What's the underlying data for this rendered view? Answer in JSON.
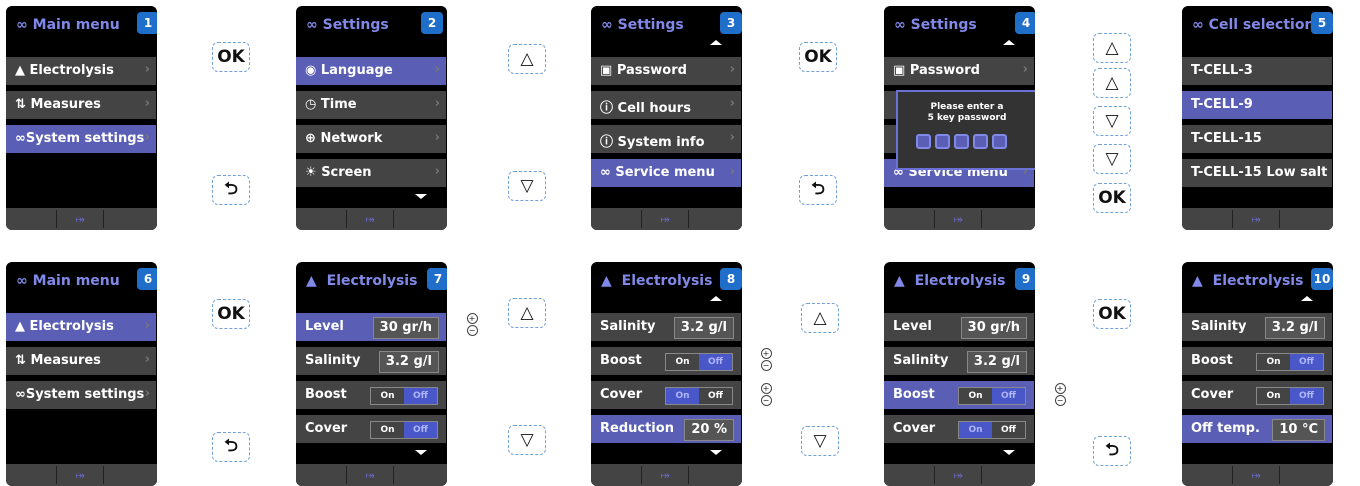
{
  "colors": {
    "accent": "#5a5fb5",
    "title": "#8089e8",
    "badge": "#1f6ec9",
    "row": "#444444"
  },
  "keys": {
    "ok": "OK",
    "up": "△",
    "down": "▽",
    "back": "⮌"
  },
  "screens": [
    {
      "badge": "1",
      "title": "Main menu",
      "rows": [
        "Electrolysis",
        "Measures",
        "System settings"
      ]
    },
    {
      "badge": "2",
      "title": "Settings",
      "rows": [
        "Language",
        "Time",
        "Network",
        "Screen"
      ]
    },
    {
      "badge": "3",
      "title": "Settings",
      "rows": [
        "Password",
        "Cell hours",
        "System info",
        "Service menu"
      ]
    },
    {
      "badge": "4",
      "title": "Settings",
      "rows": [
        "Password",
        "Service menu"
      ],
      "dialog": "Please enter a\n5 key password"
    },
    {
      "badge": "5",
      "title": "Cell selection",
      "rows": [
        "T-CELL-3",
        "T-CELL-9",
        "T-CELL-15",
        "T-CELL-15 Low salt"
      ]
    },
    {
      "badge": "6",
      "title": "Main menu",
      "rows": [
        "Electrolysis",
        "Measures",
        "System settings"
      ]
    },
    {
      "badge": "7",
      "title": "Electrolysis",
      "rows": [
        "Level",
        "Salinity",
        "Boost",
        "Cover"
      ],
      "values": [
        "30 gr/h",
        "3.2 g/l"
      ]
    },
    {
      "badge": "8",
      "title": "Electrolysis",
      "rows": [
        "Salinity",
        "Boost",
        "Cover",
        "Reduction"
      ],
      "values": [
        "3.2 g/l",
        "20 %"
      ]
    },
    {
      "badge": "9",
      "title": "Electrolysis",
      "rows": [
        "Level",
        "Salinity",
        "Boost",
        "Cover"
      ],
      "values": [
        "30 gr/h",
        "3.2 g/l"
      ]
    },
    {
      "badge": "10",
      "title": "Electrolysis",
      "rows": [
        "Salinity",
        "Boost",
        "Cover",
        "Off temp."
      ],
      "values": [
        "3.2 g/l",
        "10 °C"
      ]
    }
  ],
  "toggle": {
    "on": "On",
    "off": "Off"
  },
  "icons": {
    "wifi": "wifi-icon",
    "settings": "settings-icon",
    "electrolysis": "electrolysis-icon",
    "measures": "measures-icon"
  }
}
